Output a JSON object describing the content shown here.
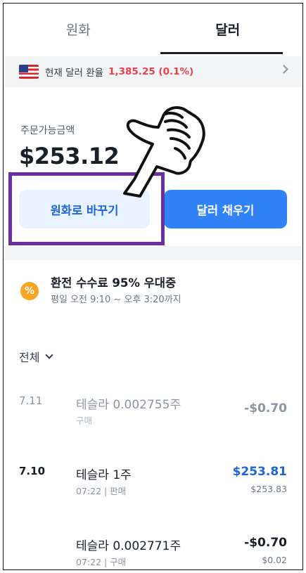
{
  "tabs": [
    {
      "label": "원화",
      "active": false
    },
    {
      "label": "달러",
      "active": true
    }
  ],
  "rate_bar": {
    "label": "현재 달러 환율",
    "value": "1,385.25 (0.1%)",
    "value_color": "#e5424d"
  },
  "balance": {
    "label": "주문가능금액",
    "amount": "$253.12"
  },
  "buttons": {
    "to_krw": "원화로 바꾸기",
    "fill_usd": "달러 채우기"
  },
  "promo": {
    "icon_glyph": "%",
    "title": "환전 수수료 95% 우대중",
    "subtitle": "평일 오전 9:10 ~ 오후 3:20까지"
  },
  "filter": {
    "label": "전체"
  },
  "transactions": [
    {
      "date": "7.11",
      "name": "테슬라 0.002755주",
      "sub": "구매",
      "amount": "-$0.70",
      "sub_amount": ""
    },
    {
      "date": "7.10",
      "name": "테슬라 1주",
      "sub": "07:22 | 판매",
      "amount": "$253.81",
      "sub_amount": "$253.83"
    },
    {
      "date": "",
      "name": "테슬라 0.002771주",
      "sub": "07:22 | 구매",
      "amount": "-$0.70",
      "sub_amount": "$0.02"
    }
  ],
  "colors": {
    "accent": "#3182f6",
    "accent_light": "#e8f3ff",
    "positive": "#1b64da",
    "highlight_box": "#6b2fa0",
    "promo_icon": "#f5a623"
  },
  "icons": {
    "flag": "us-flag-icon",
    "rate_chevron": "chevron-right-icon",
    "filter_chevron": "chevron-down-icon",
    "pointer": "pointing-hand-icon"
  }
}
